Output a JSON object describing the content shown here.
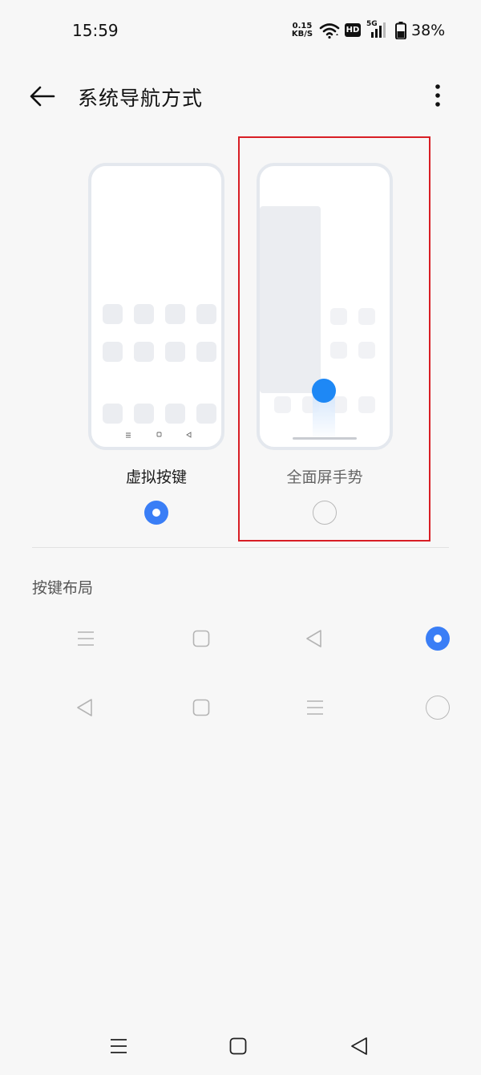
{
  "status_bar": {
    "time": "15:59",
    "net_speed_value": "0.15",
    "net_speed_unit": "KB/S",
    "hd_badge": "HD",
    "network": "5G",
    "battery_percent": "38%"
  },
  "title_bar": {
    "title": "系统导航方式",
    "back_icon": "arrow-left-icon",
    "menu_icon": "more-vertical-icon"
  },
  "nav_options": [
    {
      "label": "虚拟按键",
      "selected": true
    },
    {
      "label": "全面屏手势",
      "selected": false
    }
  ],
  "button_layout": {
    "section_title": "按键布局",
    "rows": [
      {
        "icons": [
          "menu-icon",
          "square-icon",
          "triangle-back-icon"
        ],
        "selected": true
      },
      {
        "icons": [
          "triangle-back-icon",
          "square-icon",
          "menu-icon"
        ],
        "selected": false
      }
    ]
  },
  "colors": {
    "accent": "#3a7ef6",
    "gesture_dot": "#1e88f5",
    "highlight_frame": "#d81e25",
    "background": "#f7f7f7"
  }
}
